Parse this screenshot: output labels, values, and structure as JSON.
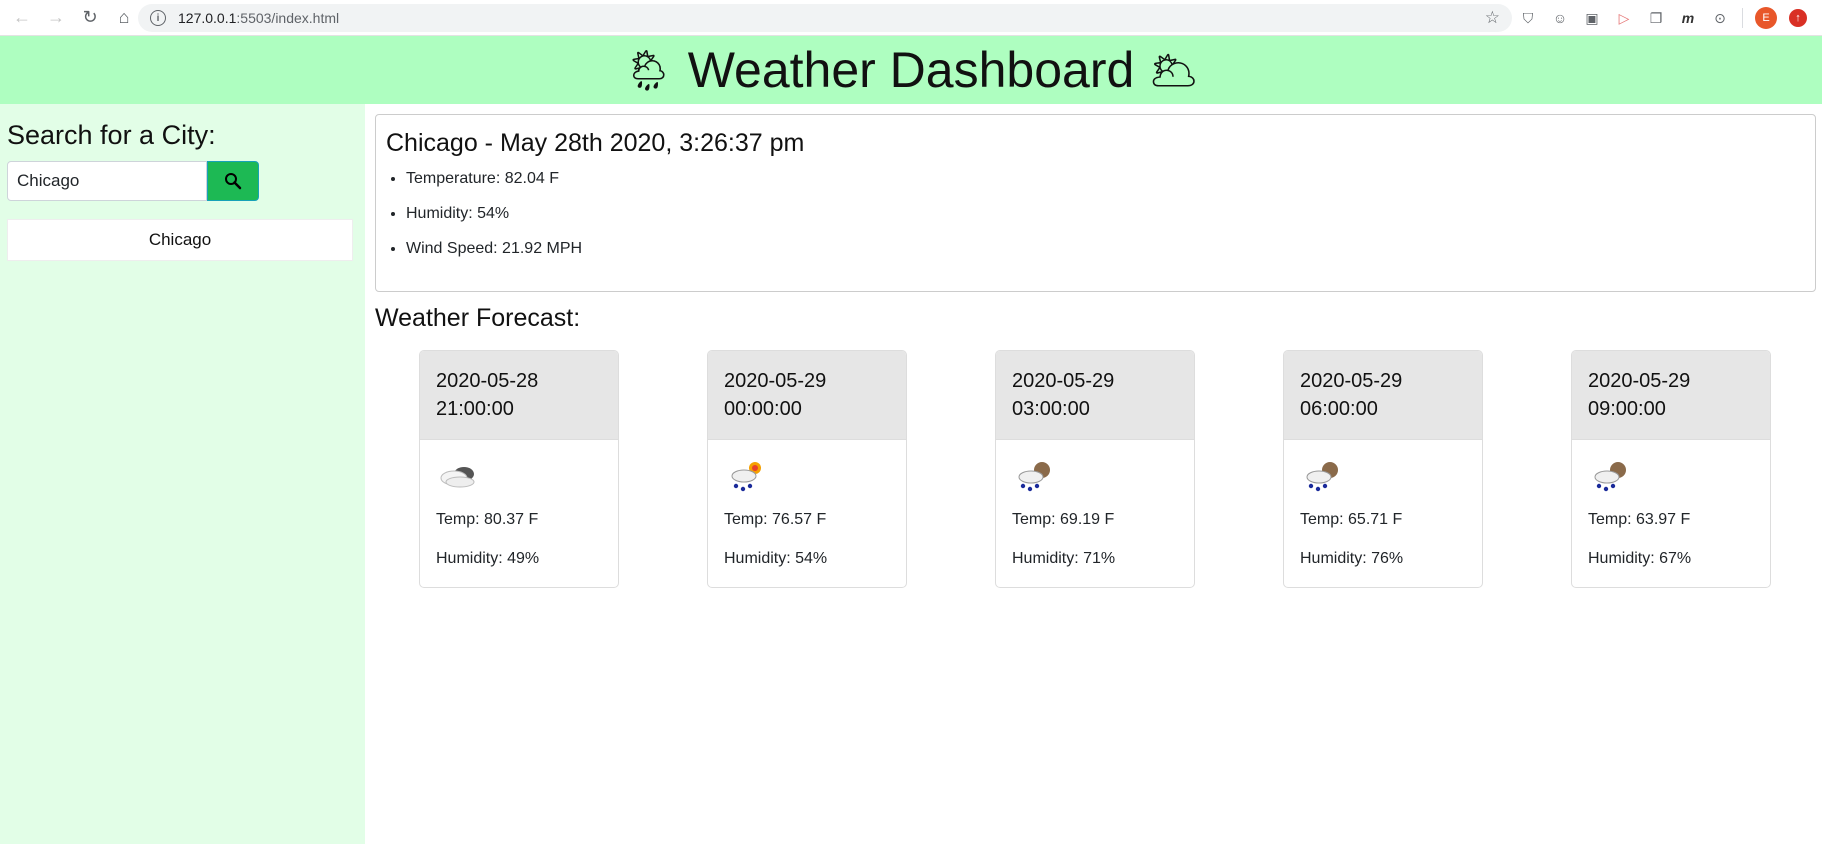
{
  "browser": {
    "url_host": "127.0.0.1",
    "url_rest": ":5503/index.html",
    "profile_initial": "E"
  },
  "header": {
    "title": "Weather Dashboard",
    "icon_left": "🌦",
    "icon_right": "🌥"
  },
  "sidebar": {
    "heading": "Search for a City:",
    "search_value": "Chicago",
    "history": [
      "Chicago"
    ]
  },
  "current": {
    "title": "Chicago - May 28th 2020, 3:26:37 pm",
    "temperature": "Temperature: 82.04 F",
    "humidity": "Humidity: 54%",
    "wind": "Wind Speed: 21.92 MPH"
  },
  "forecast": {
    "title": "Weather Forecast:",
    "cards": [
      {
        "date": "2020-05-28",
        "time": "21:00:00",
        "icon": "overcast-clouds-icon",
        "temp": "Temp: 80.37 F",
        "humidity": "Humidity: 49%"
      },
      {
        "date": "2020-05-29",
        "time": "00:00:00",
        "icon": "sun-rain-icon",
        "temp": "Temp: 76.57 F",
        "humidity": "Humidity: 54%"
      },
      {
        "date": "2020-05-29",
        "time": "03:00:00",
        "icon": "night-rain-icon",
        "temp": "Temp: 69.19 F",
        "humidity": "Humidity: 71%"
      },
      {
        "date": "2020-05-29",
        "time": "06:00:00",
        "icon": "night-rain-icon",
        "temp": "Temp: 65.71 F",
        "humidity": "Humidity: 76%"
      },
      {
        "date": "2020-05-29",
        "time": "09:00:00",
        "icon": "night-rain-icon",
        "temp": "Temp: 63.97 F",
        "humidity": "Humidity: 67%"
      }
    ]
  },
  "colors": {
    "header_bg": "#aefec0",
    "sidebar_bg": "#e2fee7",
    "search_button": "#1db954"
  }
}
